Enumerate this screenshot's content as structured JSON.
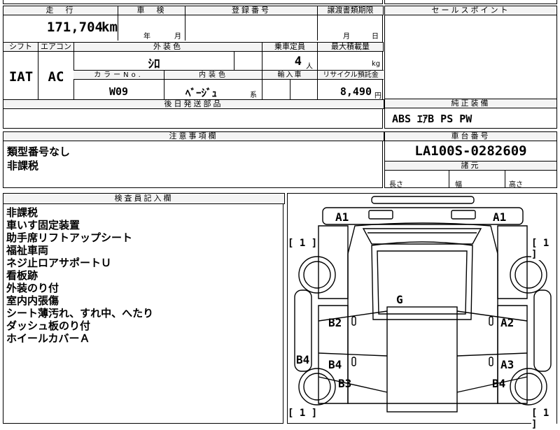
{
  "top_row": {
    "mileage_label": "走　行",
    "mileage_value": "171,704",
    "mileage_unit": "km",
    "inspection_label": "車　検",
    "inspection_year": "年",
    "inspection_month": "月",
    "registration_label": "登録番号",
    "transfer_deadline_label": "譲渡書類期限",
    "transfer_month": "月",
    "transfer_day": "日"
  },
  "second_row": {
    "shift_label": "シフト",
    "aircon_label": "エアコン",
    "exterior_color_label": "外装色",
    "exterior_color_value": "ｼﾛ",
    "capacity_label": "乗車定員",
    "capacity_value": "4",
    "capacity_unit": "人",
    "max_load_label": "最大積載量",
    "max_load_unit": "kg",
    "shift_value": "IAT",
    "aircon_value": "AC",
    "color_no_label": "カラーNo.",
    "color_no_value": "W09",
    "interior_color_label": "内装色",
    "interior_color_value": "ﾍﾞｰｼﾞｭ",
    "interior_color_suffix": "系",
    "import_label": "輸入車",
    "recycle_label": "リサイクル預託金",
    "recycle_value": "8,490",
    "recycle_unit": "円",
    "later_parts_label": "後日発送部品"
  },
  "sales_point": {
    "label": "セールスポイント"
  },
  "equipment": {
    "label": "純正装備",
    "value": "ABS ｴｱB PS PW"
  },
  "caution": {
    "label": "注意事項欄",
    "lines": [
      "類型番号なし",
      "非課税"
    ]
  },
  "chassis": {
    "label": "車台番号",
    "value": "LA100S-0282609"
  },
  "dimensions": {
    "label": "諸元",
    "length": "長さ",
    "width": "幅",
    "height": "高さ"
  },
  "inspector": {
    "label": "検査員記入欄",
    "lines": [
      "非課税",
      "車いす固定装置",
      "助手席リフトアップシート",
      "福祉車両",
      "ネジ止ロアサポートＵ",
      "看板跡",
      "外装のり付",
      "室内内張傷",
      "シート薄汚れ、すれ中、へたり",
      "ダッシュ板のり付",
      "ホイールカバーＡ"
    ]
  },
  "diagram": {
    "labels": {
      "a1_left": "A1",
      "a1_right": "A1",
      "g": "G",
      "b2": "B2",
      "a2": "A2",
      "b4_side": "B4",
      "b4_center": "B4",
      "a3": "A3",
      "b3": "B3",
      "b4_rear_right": "B4"
    },
    "tire_marks": {
      "front_left": "[ 1 ]",
      "front_right": "[ 1 ]",
      "rear_left": "[ 1 ]",
      "rear_right": "[ 1 ]"
    }
  }
}
